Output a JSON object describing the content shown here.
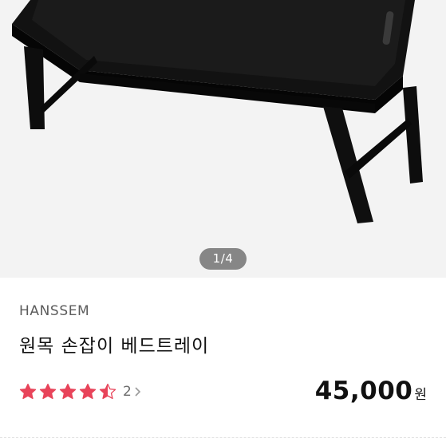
{
  "image": {
    "alt": "black wooden bed tray with folding legs",
    "indicator": "1/4"
  },
  "product": {
    "brand": "HANSSEM",
    "title": "원목 손잡이 베드트레이",
    "rating": 4.5,
    "review_count": "2",
    "price": "45,000",
    "currency": "원"
  },
  "colors": {
    "star": "#e8445a",
    "star_empty": "#d9d9d9",
    "tray": "#111111",
    "image_bg": "#f3f3f3"
  },
  "icons": [
    "star-icon",
    "chevron-right-icon"
  ]
}
